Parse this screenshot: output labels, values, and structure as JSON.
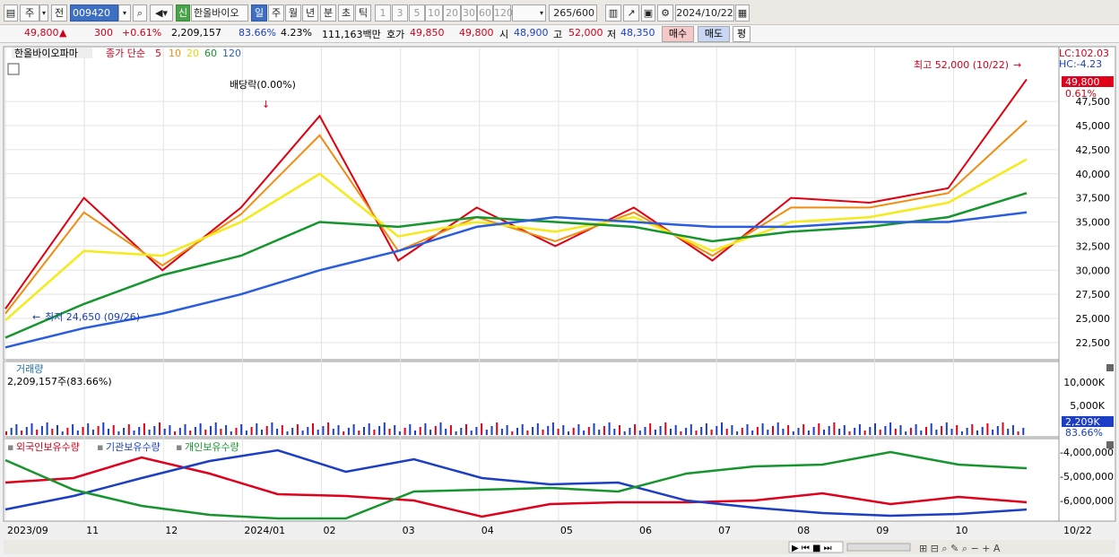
{
  "toolbar": {
    "period_button": "주",
    "prefix_button": "전",
    "code": "009420",
    "new_badge": "신",
    "stock_name": "한올바이오",
    "periods": [
      "일",
      "주",
      "월",
      "년",
      "분",
      "초",
      "틱"
    ],
    "intervals": [
      "1",
      "3",
      "5",
      "10",
      "20",
      "30",
      "60",
      "120"
    ],
    "count": "265/600",
    "date": "2024/10/22"
  },
  "quote": {
    "price": "49,800",
    "change": "300",
    "change_pct": "+0.61%",
    "volume": "2,209,157",
    "vol_ratio": "83.66%",
    "turnover": "4.23%",
    "value": "111,163백만",
    "ask_label": "호가",
    "ask": "49,850",
    "bid": "49,800",
    "open_label": "시",
    "open": "48,900",
    "high_label": "고",
    "high": "52,000",
    "low_label": "저",
    "low": "48,350",
    "buy_label": "매수",
    "sell_label": "매도",
    "avg_label": "평"
  },
  "price_panel": {
    "stock_label": "한올바이오파마",
    "ma_label": "종가 단순",
    "ma_periods": [
      "5",
      "10",
      "20",
      "60",
      "120"
    ],
    "lc": "LC:102.03",
    "hc": "HC:-4.23",
    "current": "49,800",
    "current_pct": "0.61%",
    "y_ticks": [
      "47,500",
      "45,000",
      "42,500",
      "40,000",
      "37,500",
      "35,000",
      "32,500",
      "30,000",
      "27,500",
      "25,000",
      "22,500"
    ],
    "high_note": "최고 52,000 (10/22)",
    "low_note": "최저 24,650 (09/26)",
    "dividend_note": "배당락(0.00%)"
  },
  "volume_panel": {
    "title": "거래량",
    "value_text": "2,209,157주(83.66%)",
    "y_ticks": [
      "10,000K",
      "5,000K"
    ],
    "current": "2,209K",
    "ratio": "83.66%"
  },
  "holding_panel": {
    "series": [
      "외국인보유수량",
      "기관보유수량",
      "개인보유수량"
    ],
    "y_ticks": [
      "-4,000,000",
      "-5,000,000",
      "-6,000,000"
    ]
  },
  "x_axis": {
    "labels": [
      "2023/09",
      "11",
      "12",
      "2024/01",
      "02",
      "03",
      "04",
      "05",
      "06",
      "07",
      "08",
      "09",
      "10"
    ],
    "last": "10/22"
  },
  "colors": {
    "up": "#e0001b",
    "down": "#1c3ec4",
    "ma5": "#e00010",
    "ma10": "#f08c10",
    "ma20": "#f5ea1a",
    "ma60": "#16952e",
    "ma120": "#2a5ce0"
  },
  "chart_data": {
    "type": "line",
    "title": "한올바이오파마",
    "x": [
      "2023/09",
      "11",
      "12",
      "2024/01",
      "02",
      "03",
      "04",
      "05",
      "06",
      "07",
      "08",
      "09",
      "10",
      "10/22"
    ],
    "ylim": [
      21000,
      53000
    ],
    "series": [
      {
        "name": "5",
        "values": [
          26000,
          37500,
          30000,
          36500,
          46000,
          31000,
          36500,
          32500,
          36500,
          31000,
          37500,
          37000,
          38500,
          49800
        ]
      },
      {
        "name": "10",
        "values": [
          25500,
          36000,
          30500,
          35800,
          44000,
          32000,
          35500,
          33000,
          36000,
          31500,
          36500,
          36500,
          38000,
          45500
        ]
      },
      {
        "name": "20",
        "values": [
          24800,
          32000,
          31500,
          35000,
          40000,
          33500,
          35000,
          34000,
          35500,
          32000,
          35000,
          35500,
          37000,
          41500
        ]
      },
      {
        "name": "60",
        "values": [
          23000,
          26500,
          29500,
          31500,
          35000,
          34500,
          35500,
          35000,
          34500,
          33000,
          34000,
          34500,
          35500,
          38000
        ]
      },
      {
        "name": "120",
        "values": [
          22000,
          24000,
          25500,
          27500,
          30000,
          32000,
          34500,
          35500,
          35000,
          34500,
          34500,
          35000,
          35000,
          36000
        ]
      }
    ]
  }
}
